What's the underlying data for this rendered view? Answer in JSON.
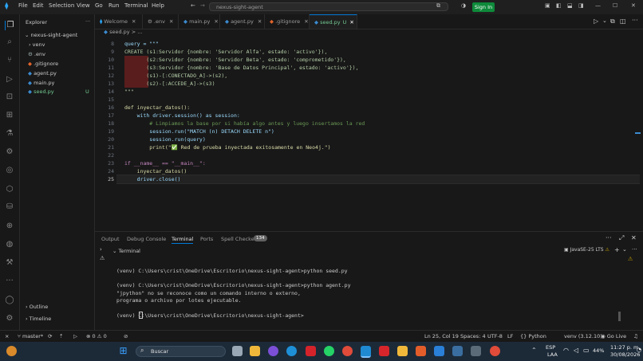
{
  "titlebar": {
    "menus": [
      "File",
      "Edit",
      "Selection",
      "View",
      "Go",
      "Run",
      "Terminal",
      "Help"
    ],
    "command_center": "nexus-sight-agent",
    "sign_in": "Sign In"
  },
  "sidebar": {
    "title": "Explorer",
    "project": "nexus-sight-agent",
    "items": [
      {
        "label": "venv",
        "kind": "folder"
      },
      {
        "label": ".env",
        "kind": "settings"
      },
      {
        "label": ".gitignore",
        "kind": "git"
      },
      {
        "label": "agent.py",
        "kind": "python"
      },
      {
        "label": "main.py",
        "kind": "python"
      },
      {
        "label": "seed.py",
        "kind": "python",
        "badge": "U"
      }
    ],
    "outline": "Outline",
    "timeline": "Timeline"
  },
  "tabs": [
    {
      "label": "Welcome"
    },
    {
      "label": ".env"
    },
    {
      "label": "main.py"
    },
    {
      "label": "agent.py"
    },
    {
      "label": ".gitignore"
    },
    {
      "label": "seed.py",
      "badge": "U",
      "active": true
    }
  ],
  "breadcrumb": {
    "file": "seed.py",
    "rest": "> ..."
  },
  "editor": {
    "line_numbers": [
      "8",
      "9",
      "10",
      "11",
      "12",
      "13",
      "14",
      "15",
      "16",
      "17",
      "18",
      "19",
      "20",
      "21",
      "22",
      "23",
      "24",
      "25"
    ],
    "lines": [
      "query = \"\"\"",
      "CREATE (s1:Servidor {nombre: 'Servidor Alfa', estado: 'activo'}),",
      "       (s2:Servidor {nombre: 'Servidor Beta', estado: 'comprometido'}),",
      "       (s3:Servidor {nombre: 'Base de Datos Principal', estado: 'activo'}),",
      "       (s1)-[:CONECTADO_A]->(s2),",
      "       (s2)-[:ACCEDE_A]->(s3)",
      "\"\"\"",
      "",
      "def inyectar_datos():",
      "    with driver.session() as session:",
      "        # Limpiamos la base por si había algo antes y luego insertamos la red",
      "        session.run(\"MATCH (n) DETACH DELETE n\")",
      "        session.run(query)",
      "        print(\"✅ Red de prueba inyectada exitosamente en Neo4j.\")",
      "",
      "if __name__ == \"__main__\":",
      "    inyectar_datos()",
      "    driver.close()"
    ]
  },
  "panel": {
    "tabs": [
      "Output",
      "Debug Console",
      "Terminal",
      "Ports",
      "Spell Checker"
    ],
    "spell_badge": "134",
    "terminal_label": "Terminal",
    "java_label": "JavaSE-25 LTS",
    "lines": [
      "(venv) C:\\Users\\crist\\OneDrive\\Escritorio\\nexus-sight-agent>python seed.py",
      "",
      "(venv) C:\\Users\\crist\\OneDrive\\Escritorio\\nexus-sight-agent>python agent.py",
      "\"jpython\" no se reconoce como un comando interno o externo,",
      "programa o archivo por lotes ejecutable.",
      "",
      "(venv) C:\\Users\\crist\\OneDrive\\Escritorio\\nexus-sight-agent>"
    ]
  },
  "status": {
    "branch": "master*",
    "problems": "0",
    "warnings": "0",
    "position": "Ln 25, Col 19",
    "spaces": "Spaces: 4",
    "encoding": "UTF-8",
    "eol": "LF",
    "language": "Python",
    "env": "venv (3.12.10)",
    "golive": "Go Live"
  },
  "taskbar": {
    "search": "Buscar",
    "lang": "ESP",
    "lang2": "LAA",
    "battery": "44%",
    "time": "11:27 p. m.",
    "date": "30/08/2026"
  },
  "colors": {
    "accent": "#0078d4",
    "signin": "#0e8a3a",
    "taskbar": "#1c2a38"
  }
}
